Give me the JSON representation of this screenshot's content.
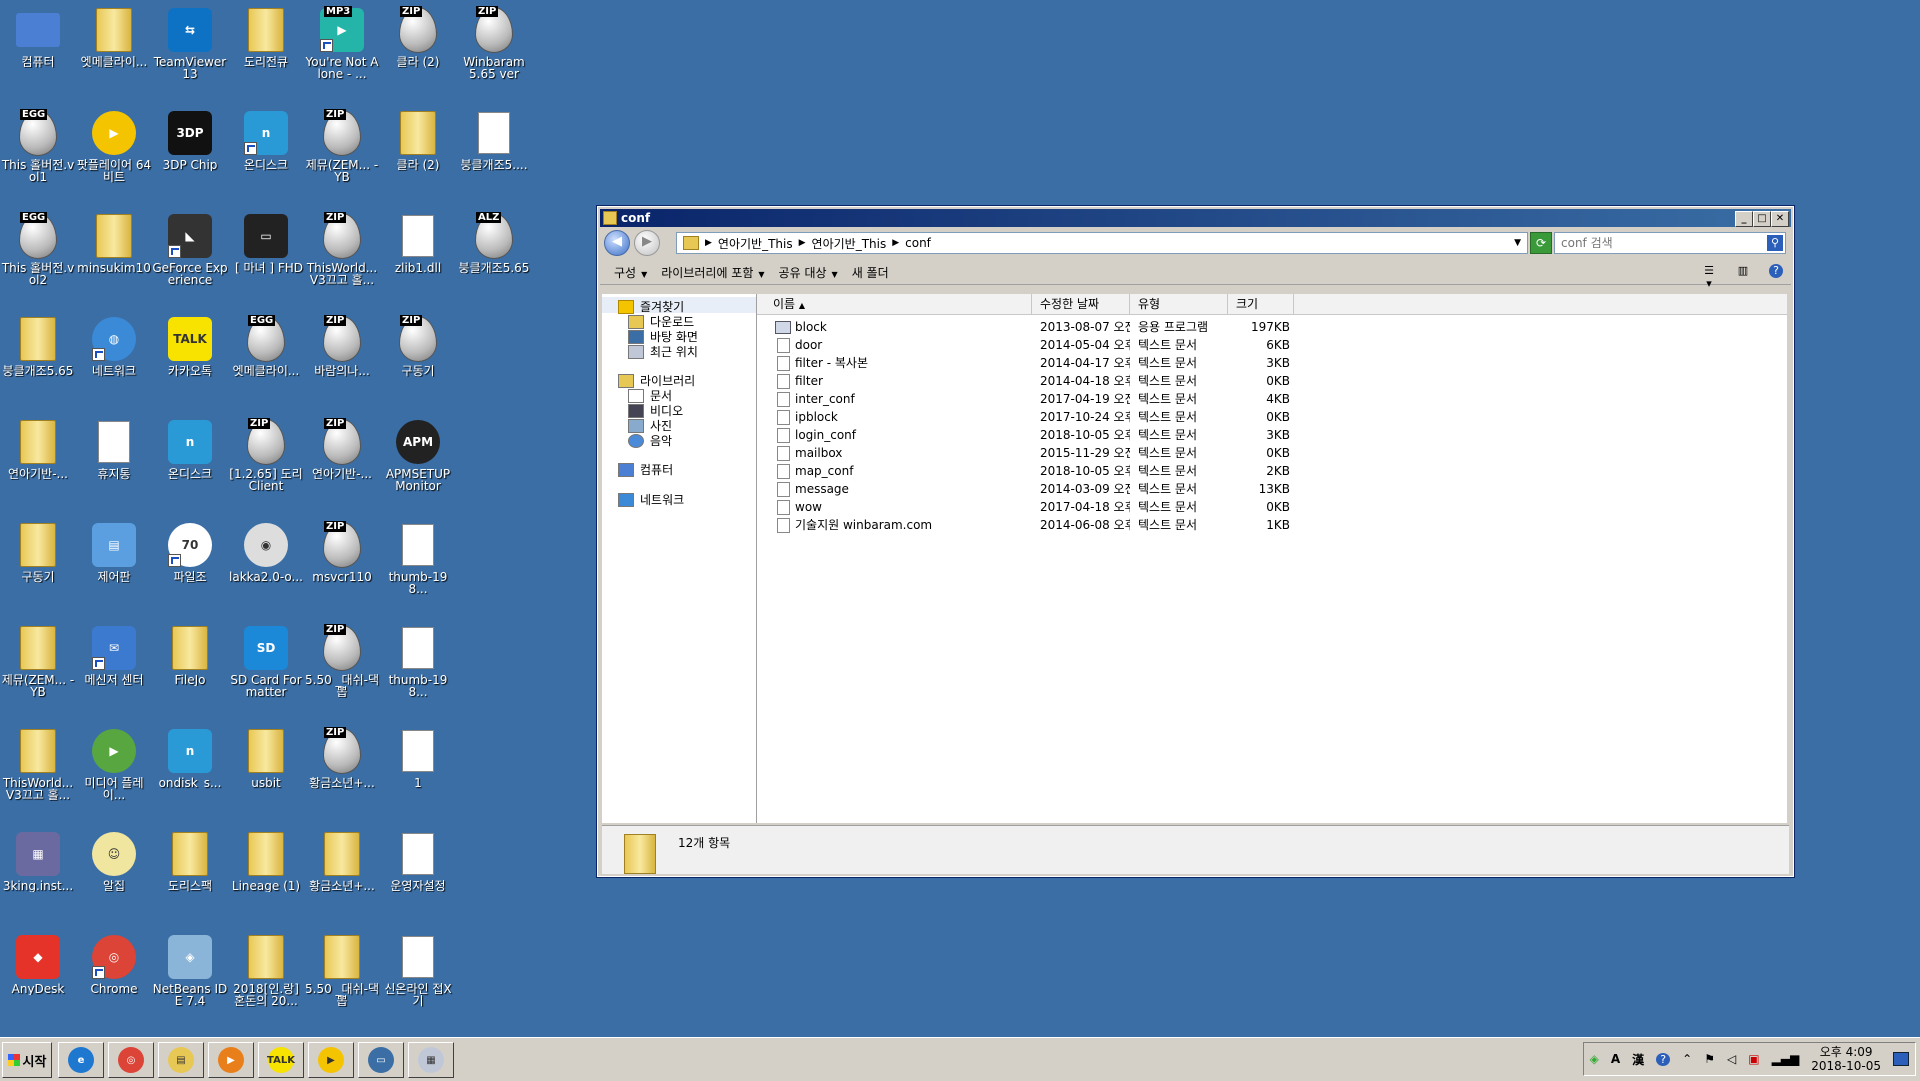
{
  "desktop": {
    "icons": [
      {
        "label": "컴퓨터",
        "kind": "computer",
        "color": "#4a7fd4"
      },
      {
        "label": "엣메클라이...",
        "kind": "folder"
      },
      {
        "label": "TeamViewer 13",
        "kind": "square",
        "color": "#0e72c4",
        "text": "⇆"
      },
      {
        "label": "도리전큐",
        "kind": "folder"
      },
      {
        "label": "You're Not Alone - ...",
        "kind": "square",
        "color": "#25b5a8",
        "text": "▶",
        "badge": "MP3"
      },
      {
        "label": "클라 (2)",
        "kind": "egg",
        "badge": "ZIP"
      },
      {
        "label": "Winbaram 5.65 ver",
        "kind": "egg",
        "badge": "ZIP"
      },
      {
        "label": "This 홀버전.vol1",
        "kind": "egg",
        "badge": "EGG"
      },
      {
        "label": "팟플레이어 64 비트",
        "kind": "circle",
        "color": "#f5c400",
        "text": "▶"
      },
      {
        "label": "3DP Chip",
        "kind": "square",
        "color": "#111111",
        "text": "3DP"
      },
      {
        "label": "온디스크",
        "kind": "square",
        "color": "#2a9ad6",
        "text": "n"
      },
      {
        "label": "제뮤(ZEM... - YB",
        "kind": "egg",
        "badge": "ZIP"
      },
      {
        "label": "클라 (2)",
        "kind": "folder"
      },
      {
        "label": "붕클개조5....",
        "kind": "doc"
      },
      {
        "label": "This 홀버전.vol2",
        "kind": "egg",
        "badge": "EGG"
      },
      {
        "label": "minsukim10",
        "kind": "folder"
      },
      {
        "label": "GeForce Experience",
        "kind": "square",
        "color": "#333333",
        "text": "◣"
      },
      {
        "label": "_[ 마녀 ] FHD",
        "kind": "square",
        "color": "#222222",
        "text": "▭"
      },
      {
        "label": "ThisWorld... V3끄고 홀...",
        "kind": "egg",
        "badge": "ZIP"
      },
      {
        "label": "zlib1.dll",
        "kind": "doc"
      },
      {
        "label": "붕클개조5.65",
        "kind": "egg",
        "badge": "ALZ"
      },
      {
        "label": "붕클개조5.65",
        "kind": "folder"
      },
      {
        "label": "네트워크",
        "kind": "circle",
        "color": "#3a8ad8",
        "text": "◍"
      },
      {
        "label": "카카오톡",
        "kind": "square",
        "color": "#f7e200",
        "text": "TALK"
      },
      {
        "label": "엣메클라이...",
        "kind": "egg",
        "badge": "EGG"
      },
      {
        "label": "바람의나...",
        "kind": "egg",
        "badge": "ZIP"
      },
      {
        "label": "구동기",
        "kind": "egg",
        "badge": "ZIP"
      },
      {
        "label": "",
        "kind": "none"
      },
      {
        "label": "연아기반-...",
        "kind": "folder"
      },
      {
        "label": "휴지통",
        "kind": "doc"
      },
      {
        "label": "온디스크",
        "kind": "square",
        "color": "#2a9ad6",
        "text": "n"
      },
      {
        "label": "[1.2.65] 도리 Client",
        "kind": "egg",
        "badge": "ZIP"
      },
      {
        "label": "연아기반-...",
        "kind": "egg",
        "badge": "ZIP"
      },
      {
        "label": "APMSETUP Monitor",
        "kind": "circle",
        "color": "#222222",
        "text": "APM"
      },
      {
        "label": "",
        "kind": "none"
      },
      {
        "label": "구동기",
        "kind": "folder"
      },
      {
        "label": "제어판",
        "kind": "square",
        "color": "#5c9fe0",
        "text": "▤"
      },
      {
        "label": "파일조",
        "kind": "circle",
        "color": "#ffffff",
        "text": "70"
      },
      {
        "label": "lakka2.0-o...",
        "kind": "circle",
        "color": "#dddddd",
        "text": "◉"
      },
      {
        "label": "msvcr110",
        "kind": "egg",
        "badge": "ZIP"
      },
      {
        "label": "thumb-198...",
        "kind": "doc"
      },
      {
        "label": "",
        "kind": "none"
      },
      {
        "label": "제뮤(ZEM... - YB",
        "kind": "folder"
      },
      {
        "label": "메신저 센터",
        "kind": "square",
        "color": "#3c7ad0",
        "text": "✉"
      },
      {
        "label": "FileJo",
        "kind": "folder"
      },
      {
        "label": "SD Card Formatter",
        "kind": "square",
        "color": "#1b88d8",
        "text": "SD"
      },
      {
        "label": "5.50 _대쉬-댁뽑",
        "kind": "egg",
        "badge": "ZIP"
      },
      {
        "label": "thumb-198...",
        "kind": "doc"
      },
      {
        "label": "",
        "kind": "none"
      },
      {
        "label": "ThisWorld... V3끄고 홀...",
        "kind": "folder"
      },
      {
        "label": "미디어 플레이...",
        "kind": "circle",
        "color": "#58a640",
        "text": "▶"
      },
      {
        "label": "ondisk_s...",
        "kind": "square",
        "color": "#2a9ad6",
        "text": "n"
      },
      {
        "label": "usbit",
        "kind": "folder"
      },
      {
        "label": "황금소년+...",
        "kind": "egg",
        "badge": "ZIP"
      },
      {
        "label": "1",
        "kind": "doc"
      },
      {
        "label": "",
        "kind": "none"
      },
      {
        "label": "3king.inst...",
        "kind": "square",
        "color": "#6a6aa0",
        "text": "▦"
      },
      {
        "label": "알집",
        "kind": "circle",
        "color": "#f0e6a0",
        "text": "☺"
      },
      {
        "label": "도리스팩",
        "kind": "folder"
      },
      {
        "label": "Lineage (1)",
        "kind": "folder"
      },
      {
        "label": "황금소년+...",
        "kind": "folder"
      },
      {
        "label": "운영자설정",
        "kind": "doc"
      },
      {
        "label": "",
        "kind": "none"
      },
      {
        "label": "AnyDesk",
        "kind": "square",
        "color": "#e5332a",
        "text": "◆"
      },
      {
        "label": "Chrome",
        "kind": "circle",
        "color": "#db4437",
        "text": "◎"
      },
      {
        "label": "NetBeans IDE 7.4",
        "kind": "square",
        "color": "#8ab4d8",
        "text": "◈"
      },
      {
        "label": "2018[인.랑] 혼돈의 20...",
        "kind": "folder"
      },
      {
        "label": "5.50 _대쉬-댁뽑",
        "kind": "folder"
      },
      {
        "label": "신온라인 접X기",
        "kind": "doc"
      },
      {
        "label": "",
        "kind": "none"
      }
    ]
  },
  "window": {
    "title": "conf",
    "buttons": {
      "minimize": "_",
      "maximize": "□",
      "close": "✕"
    },
    "breadcrumb": [
      "연아기반_This",
      "연아기반_This",
      "conf"
    ],
    "search_placeholder": "conf 검색",
    "toolbar": {
      "organize": "구성",
      "include_library": "라이브러리에 포함",
      "share_with": "공유 대상",
      "new_folder": "새 폴더"
    },
    "nav": {
      "favorites": "즐겨찾기",
      "downloads": "다운로드",
      "desktop": "바탕 화면",
      "recent": "최근 위치",
      "libraries": "라이브러리",
      "documents": "문서",
      "videos": "비디오",
      "pictures": "사진",
      "music": "음악",
      "computer": "컴퓨터",
      "network": "네트워크"
    },
    "columns": {
      "name": "이름",
      "date": "수정한 날짜",
      "type": "유형",
      "size": "크기"
    },
    "files": [
      {
        "name": "block",
        "date": "2013-08-07 오전 ...",
        "type": "응용 프로그램",
        "size": "197KB",
        "app": true
      },
      {
        "name": "door",
        "date": "2014-05-04 오후 ...",
        "type": "텍스트 문서",
        "size": "6KB"
      },
      {
        "name": "filter - 복사본",
        "date": "2014-04-17 오후 ...",
        "type": "텍스트 문서",
        "size": "3KB"
      },
      {
        "name": "filter",
        "date": "2014-04-18 오후 ...",
        "type": "텍스트 문서",
        "size": "0KB"
      },
      {
        "name": "inter_conf",
        "date": "2017-04-19 오전 ...",
        "type": "텍스트 문서",
        "size": "4KB"
      },
      {
        "name": "ipblock",
        "date": "2017-10-24 오후 ...",
        "type": "텍스트 문서",
        "size": "0KB"
      },
      {
        "name": "login_conf",
        "date": "2018-10-05 오후 ...",
        "type": "텍스트 문서",
        "size": "3KB"
      },
      {
        "name": "mailbox",
        "date": "2015-11-29 오전 ...",
        "type": "텍스트 문서",
        "size": "0KB"
      },
      {
        "name": "map_conf",
        "date": "2018-10-05 오후 ...",
        "type": "텍스트 문서",
        "size": "2KB"
      },
      {
        "name": "message",
        "date": "2014-03-09 오전 ...",
        "type": "텍스트 문서",
        "size": "13KB"
      },
      {
        "name": "wow",
        "date": "2017-04-18 오후 ...",
        "type": "텍스트 문서",
        "size": "0KB"
      },
      {
        "name": "기술지원 winbaram.com",
        "date": "2014-06-08 오후 ...",
        "type": "텍스트 문서",
        "size": "1KB"
      }
    ],
    "status_text": "12개 항목"
  },
  "taskbar": {
    "start_label": "시작",
    "apps": [
      {
        "name": "ie",
        "color": "#1e78d0",
        "text": "e"
      },
      {
        "name": "chrome",
        "color": "#db4437",
        "text": "◎"
      },
      {
        "name": "explorer",
        "color": "#e8c855",
        "text": "▤"
      },
      {
        "name": "media",
        "color": "#e87f1a",
        "text": "▶"
      },
      {
        "name": "kakaotalk",
        "color": "#f7e200",
        "text": "TALK"
      },
      {
        "name": "potplayer",
        "color": "#f5c400",
        "text": "▶"
      },
      {
        "name": "remote-desktop",
        "color": "#3a6ea5",
        "text": "▭"
      },
      {
        "name": "window-app",
        "color": "#c0c8d8",
        "text": "▦"
      }
    ],
    "ime_a": "A",
    "ime_han": "漢",
    "clock_time": "오후 4:09",
    "clock_date": "2018-10-05"
  }
}
